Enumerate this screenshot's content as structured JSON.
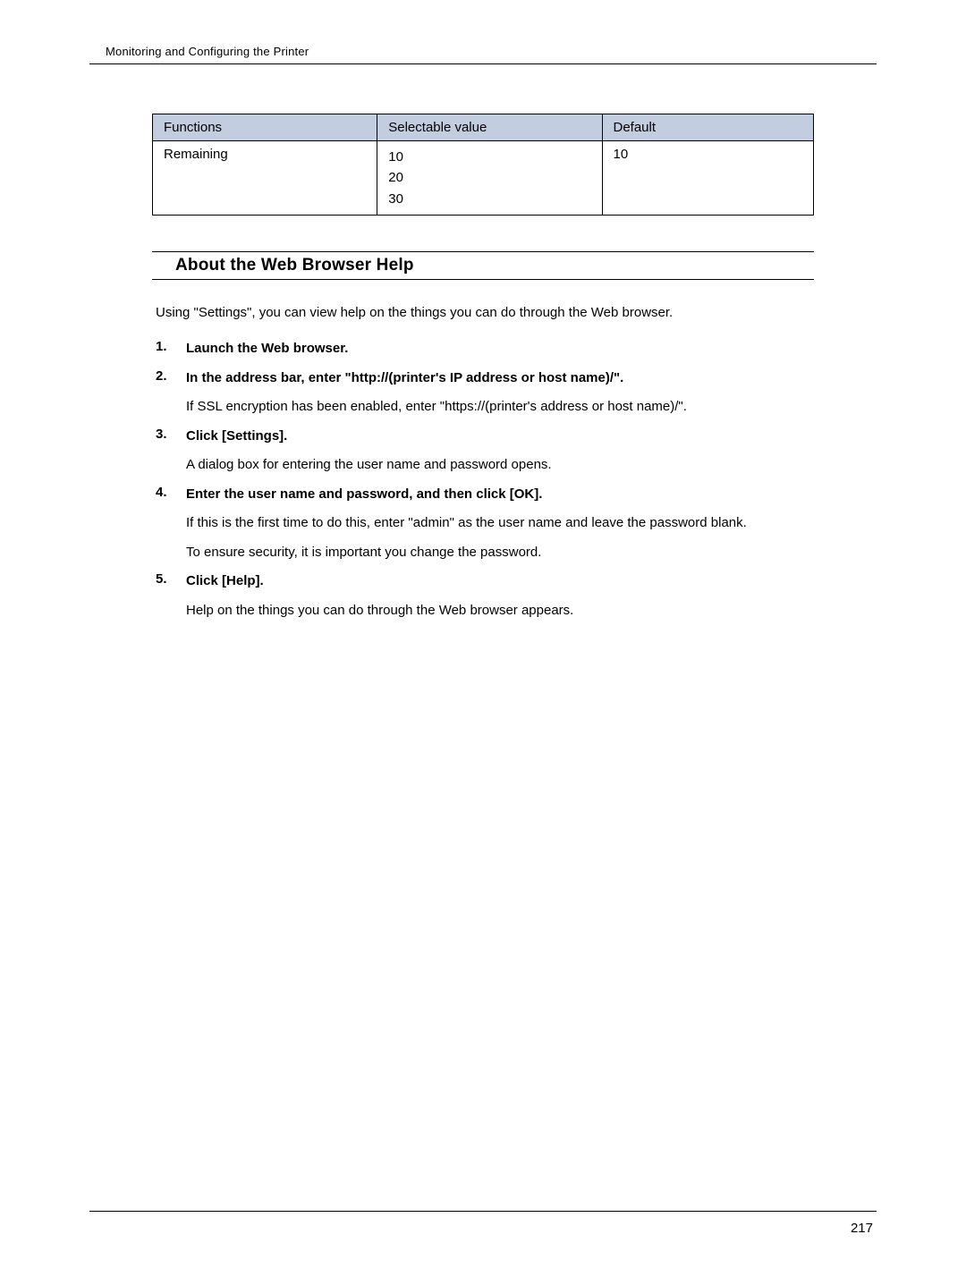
{
  "header": {
    "running_title": "Monitoring and Configuring the Printer"
  },
  "table": {
    "headers": {
      "functions": "Functions",
      "selectable": "Selectable value",
      "default": "Default"
    },
    "row": {
      "function": "Remaining",
      "values": [
        "10",
        "20",
        "30"
      ],
      "default": "10"
    }
  },
  "section": {
    "title": "About the Web Browser Help",
    "intro": "Using \"Settings\", you can view help on the things you can do through the Web browser.",
    "steps": [
      {
        "title": "Launch the Web browser.",
        "body": []
      },
      {
        "title": "In the address bar, enter \"http://(printer's IP address or host name)/\".",
        "body": [
          "If SSL encryption has been enabled, enter \"https://(printer's address or host name)/\"."
        ]
      },
      {
        "title": "Click [Settings].",
        "body": [
          "A dialog box for entering the user name and password opens."
        ]
      },
      {
        "title": "Enter the user name and password, and then click [OK].",
        "body": [
          "If this is the first time to do this, enter \"admin\" as the user name and leave the password blank.",
          "To ensure security, it is important you change the password."
        ]
      },
      {
        "title": "Click [Help].",
        "body": [
          "Help on the things you can do through the Web browser appears."
        ]
      }
    ]
  },
  "footer": {
    "page_number": "217"
  }
}
